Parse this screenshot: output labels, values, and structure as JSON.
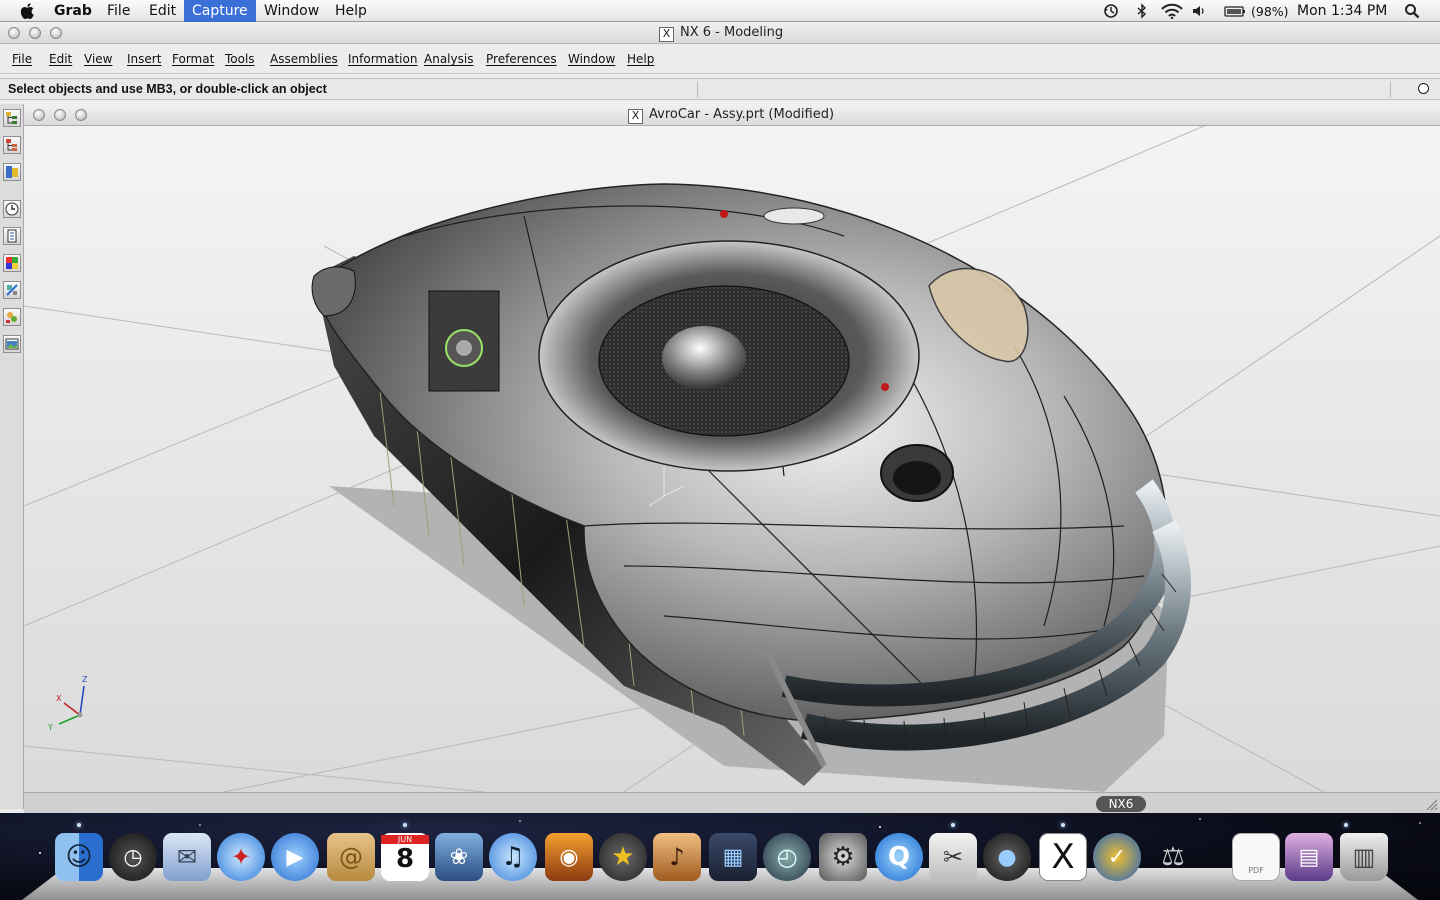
{
  "menubar": {
    "app": "Grab",
    "items": [
      "File",
      "Edit",
      "Capture",
      "Window",
      "Help"
    ],
    "active": "Capture",
    "battery": "(98%)",
    "clock": "Mon 1:34 PM",
    "status_icons": [
      "time-machine-icon",
      "bluetooth-icon",
      "wifi-icon",
      "volume-icon",
      "battery-icon",
      "spotlight-icon"
    ]
  },
  "nx_window": {
    "title": "NX 6 - Modeling",
    "menu": [
      "File",
      "Edit",
      "View",
      "Insert",
      "Format",
      "Tools",
      "Assemblies",
      "Information",
      "Analysis",
      "Preferences",
      "Window",
      "Help"
    ],
    "cue": "Select objects and use MB3, or double-click an object"
  },
  "resource_bar": {
    "icons": [
      "assembly-navigator-icon",
      "part-navigator-icon",
      "reuse-library-icon",
      "history-icon",
      "system-materials-icon",
      "palette-icon",
      "roles-icon",
      "process-studio-icon",
      "web-browser-icon"
    ]
  },
  "part_window": {
    "title": "AvroCar - Assy.prt (Modified)",
    "triad_labels": {
      "z": "Z",
      "x": "X",
      "y": "Y"
    }
  },
  "status": {
    "badge": "NX6"
  },
  "dock": {
    "items": [
      "finder-icon",
      "dashboard-icon",
      "mail-icon",
      "safari-icon",
      "ichat-icon",
      "address-book-icon",
      "ical-icon",
      "iphoto-icon",
      "itunes-icon",
      "photo-booth-icon",
      "imovie-icon",
      "garageband-icon",
      "spaces-icon",
      "time-machine-icon",
      "system-preferences-icon",
      "quicktime-icon",
      "grab-icon",
      "3dconnexion-icon",
      "x11-icon",
      "nx-icon",
      "instruments-icon",
      "pdf-document-icon",
      "image-stack-icon",
      "trash-icon"
    ],
    "ical_month": "JUN",
    "ical_day": "8",
    "pdf_label": "PDF",
    "running": [
      "finder-icon",
      "ical-icon",
      "grab-icon",
      "x11-icon"
    ]
  }
}
